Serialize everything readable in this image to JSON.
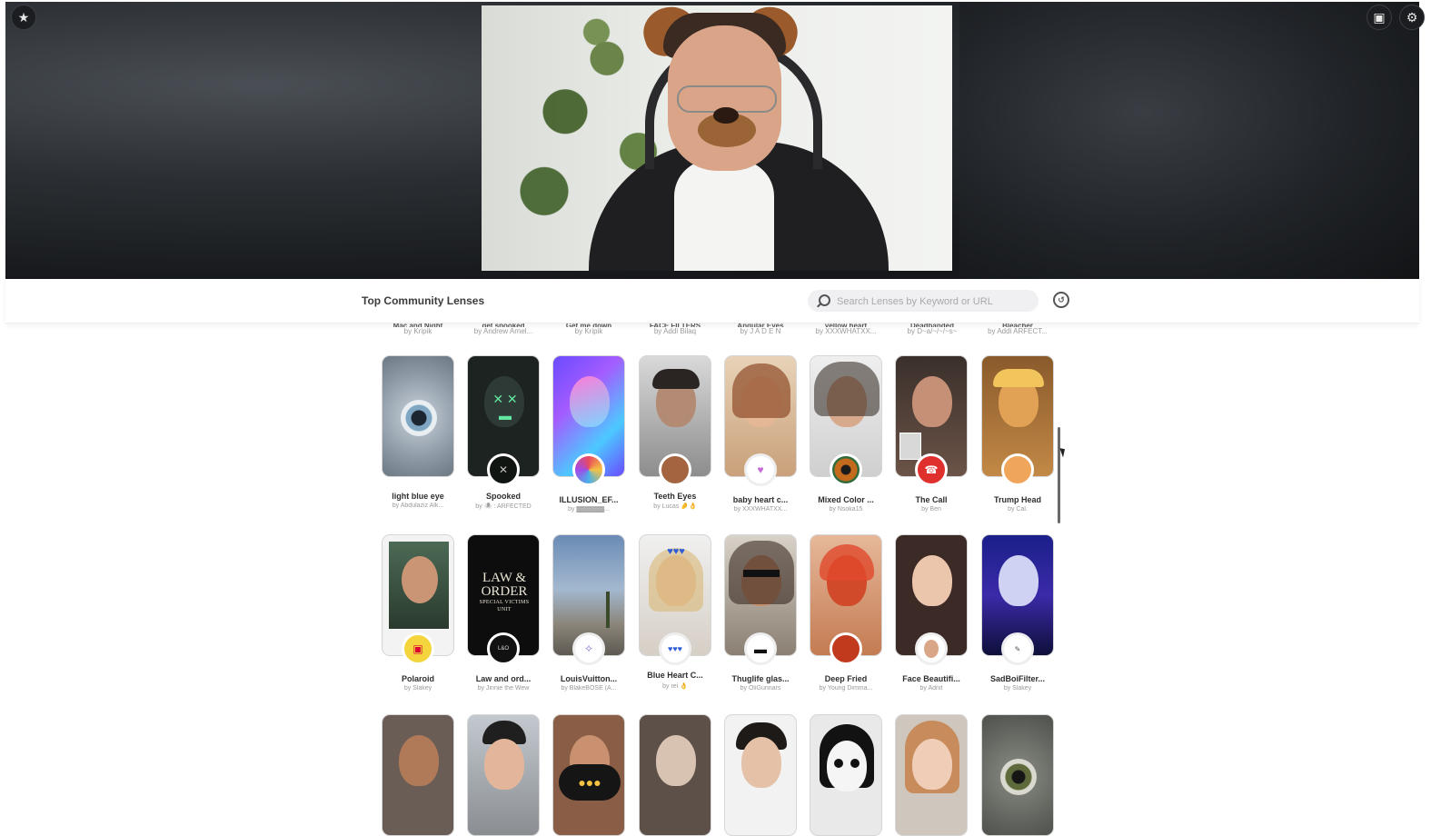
{
  "hero": {
    "left_icon": "star-icon",
    "right_icons": [
      "twitch-icon",
      "settings-icon"
    ]
  },
  "header": {
    "title": "Top Community Lenses",
    "search_placeholder": "Search Lenses by Keyword or URL",
    "history_icon": "history-icon"
  },
  "partial_row": [
    {
      "title": "Mac and Night",
      "author": "by Kripik"
    },
    {
      "title": "get spooked",
      "author": "by Andrew Arnel..."
    },
    {
      "title": "Get me down",
      "author": "by Kripik"
    },
    {
      "title": "FACE FILTERS",
      "author": "by Addi Bilaq"
    },
    {
      "title": "Angular Eyes",
      "author": "by J A D E N"
    },
    {
      "title": "yellow heart",
      "author": "by XXXWHATXX..."
    },
    {
      "title": "Deadbanded",
      "author": "by D~a/~/~/~s~"
    },
    {
      "title": "Bleacher",
      "author": "by Addi ARFECT..."
    }
  ],
  "rows": [
    [
      {
        "title": "light blue eye",
        "author": "by Abdulaziz Alk..."
      },
      {
        "title": "Spooked",
        "author": "by 🕷 : ARFECTED"
      },
      {
        "title": "ILLUSION_EF...",
        "author": "by ▓▓▓▓▓▓..."
      },
      {
        "title": "Teeth Eyes",
        "author": "by Lucas 🤌👌"
      },
      {
        "title": "baby heart c...",
        "author": "by XXXWHATXX..."
      },
      {
        "title": "Mixed Color ...",
        "author": "by Nsoka15"
      },
      {
        "title": "The Call",
        "author": "by Ben"
      },
      {
        "title": "Trump Head",
        "author": "by Cal."
      }
    ],
    [
      {
        "title": "Polaroid",
        "author": "by Slakey"
      },
      {
        "title": "Law and ord...",
        "author": "by Jinnie the Wew"
      },
      {
        "title": "LouisVuitton...",
        "author": "by BlakeBOSE (A..."
      },
      {
        "title": "Blue Heart C...",
        "author": "by rei 👌"
      },
      {
        "title": "Thuglife glas...",
        "author": "by OliGunnars"
      },
      {
        "title": "Deep Fried",
        "author": "by Young Dimma..."
      },
      {
        "title": "Face Beautifi...",
        "author": "by Adnit"
      },
      {
        "title": "SadBoiFilter...",
        "author": "by Slakey"
      }
    ]
  ],
  "law_order_art": {
    "line1": "LAW &",
    "line2": "ORDER",
    "line3": "SPECIAL VICTIMS UNIT"
  }
}
